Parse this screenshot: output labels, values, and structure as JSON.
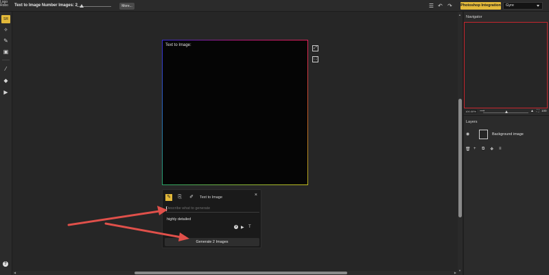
{
  "topbar": {
    "logo_alt": "Logo Robo",
    "number_images_label": "Text to Image Number Images: 2",
    "more_label": "More...",
    "photoshop_label": "Photoshop Integration",
    "model_select": "Gyre",
    "icons": [
      "menu-icon",
      "undo-icon",
      "redo-icon"
    ]
  },
  "tools": {
    "active_label": "SR",
    "items": [
      "select-tool-icon",
      "magic-wand-icon",
      "pencil-icon",
      "frame-icon",
      "brush-icon",
      "eraser-icon",
      "pointer-icon"
    ]
  },
  "canvas": {
    "title": "Text to Image:",
    "side_icons": [
      "expand-icon",
      "fit-icon"
    ]
  },
  "prompt_panel": {
    "mode_title": "Text to Image",
    "placeholder": "Describe what to generate",
    "style_text": "highly detailed",
    "generate_label": "Generate 2 Images",
    "close": "×"
  },
  "navigator": {
    "title": "Navigator",
    "zoom": "100.00%",
    "zoom_right": "100"
  },
  "layers": {
    "title": "Layers",
    "items": [
      {
        "name": "Background image"
      }
    ]
  },
  "help": "?",
  "colors": {
    "accent": "#e3b93a",
    "arrow": "#e0504a",
    "navigator_frame": "#c8262e"
  }
}
